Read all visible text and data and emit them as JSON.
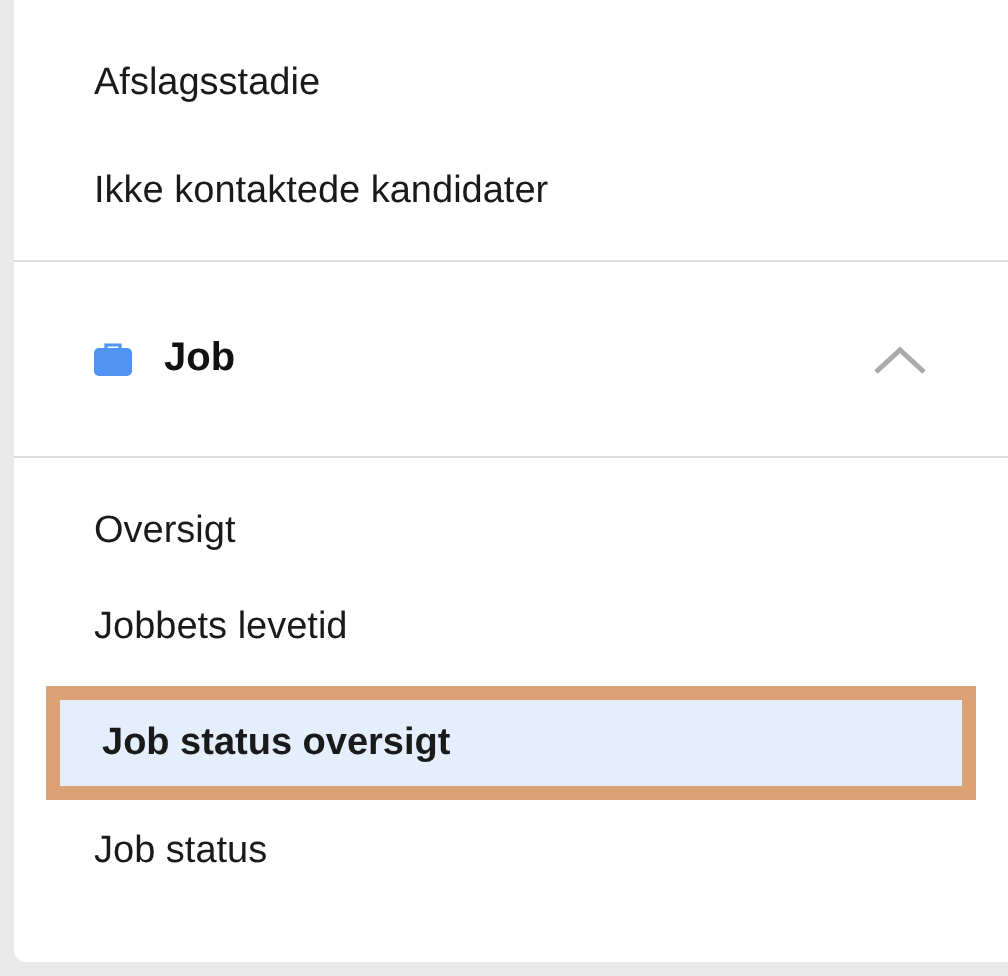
{
  "top_items": [
    {
      "label": "Afslagsstadie"
    },
    {
      "label": "Ikke kontaktede kandidater"
    }
  ],
  "section": {
    "title": "Job",
    "expanded": true,
    "items": [
      {
        "label": "Oversigt",
        "selected": false
      },
      {
        "label": "Jobbets levetid",
        "selected": false
      },
      {
        "label": "Job status oversigt",
        "selected": true
      },
      {
        "label": "Job status",
        "selected": false
      }
    ]
  }
}
